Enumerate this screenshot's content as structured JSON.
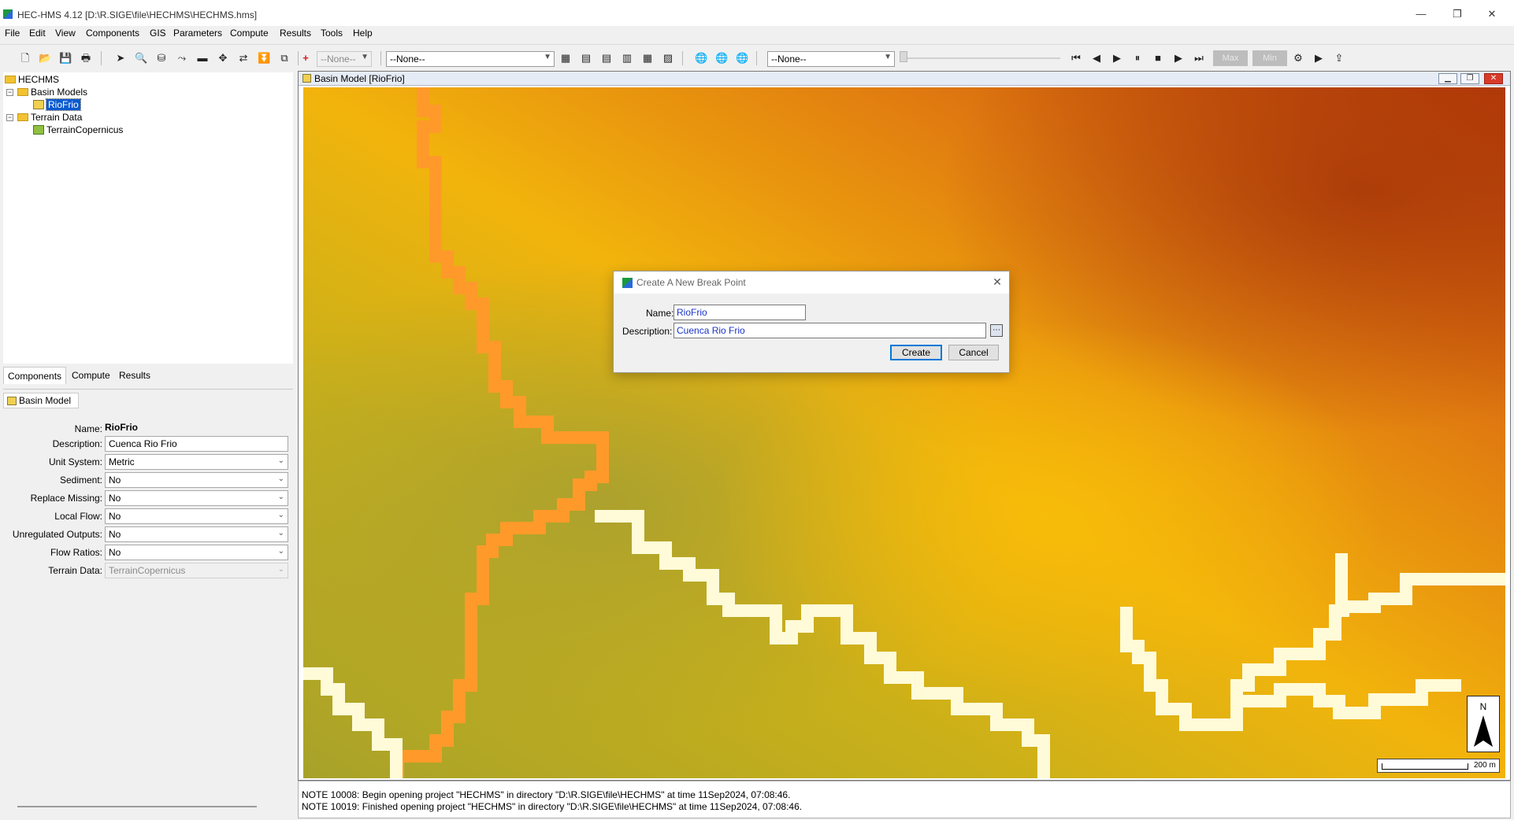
{
  "window": {
    "title": "HEC-HMS 4.12 [D:\\R.SIGE\\file\\HECHMS\\HECHMS.hms]",
    "controls": [
      "—",
      "❐",
      "✕"
    ]
  },
  "menu": [
    "File",
    "Edit",
    "View",
    "Components",
    "GIS",
    "Parameters",
    "Compute",
    "Results",
    "Tools",
    "Help"
  ],
  "toolbar": {
    "combo_small": "--None--",
    "combo_element": "--None--",
    "combo_time": "--None--",
    "max_label": "Max",
    "min_label": "Min"
  },
  "tree": {
    "root": "HECHMS",
    "basin_models_label": "Basin Models",
    "basin_model_item": "RioFrio",
    "terrain_data_label": "Terrain Data",
    "terrain_item": "TerrainCopernicus"
  },
  "tabs": [
    "Components",
    "Compute",
    "Results"
  ],
  "properties": {
    "header": "Basin Model",
    "rows": [
      {
        "label": "Name:",
        "value": "RioFrio"
      },
      {
        "label": "Description:",
        "value": "Cuenca Rio Frio"
      },
      {
        "label": "Unit System:",
        "value": "Metric"
      },
      {
        "label": "Sediment:",
        "value": "No"
      },
      {
        "label": "Replace Missing:",
        "value": "No"
      },
      {
        "label": "Local Flow:",
        "value": "No"
      },
      {
        "label": "Unregulated Outputs:",
        "value": "No"
      },
      {
        "label": "Flow Ratios:",
        "value": "No"
      },
      {
        "label": "Terrain Data:",
        "value": "TerrainCopernicus"
      }
    ]
  },
  "map": {
    "title": "Basin Model [RioFrio]",
    "north_label": "N",
    "scale_label": "200 m",
    "colors": {
      "low": "#a8a22a",
      "mid": "#f0b010",
      "high": "#c84a10",
      "stream_white": "#fffbd8",
      "stream_orange": "#ff9a2a"
    }
  },
  "console": {
    "lines": [
      "NOTE 10008:  Begin opening project \"HECHMS\" in directory \"D:\\R.SIGE\\file\\HECHMS\" at time 11Sep2024, 07:08:46.",
      "NOTE 10019:  Finished opening project \"HECHMS\" in directory \"D:\\R.SIGE\\file\\HECHMS\" at time 11Sep2024, 07:08:46."
    ]
  },
  "dialog": {
    "title": "Create A New Break Point",
    "name_label": "Name:",
    "name_value": "RioFrio",
    "description_label": "Description:",
    "description_value": "Cuenca Rio Frio",
    "create_label": "Create",
    "cancel_label": "Cancel"
  }
}
